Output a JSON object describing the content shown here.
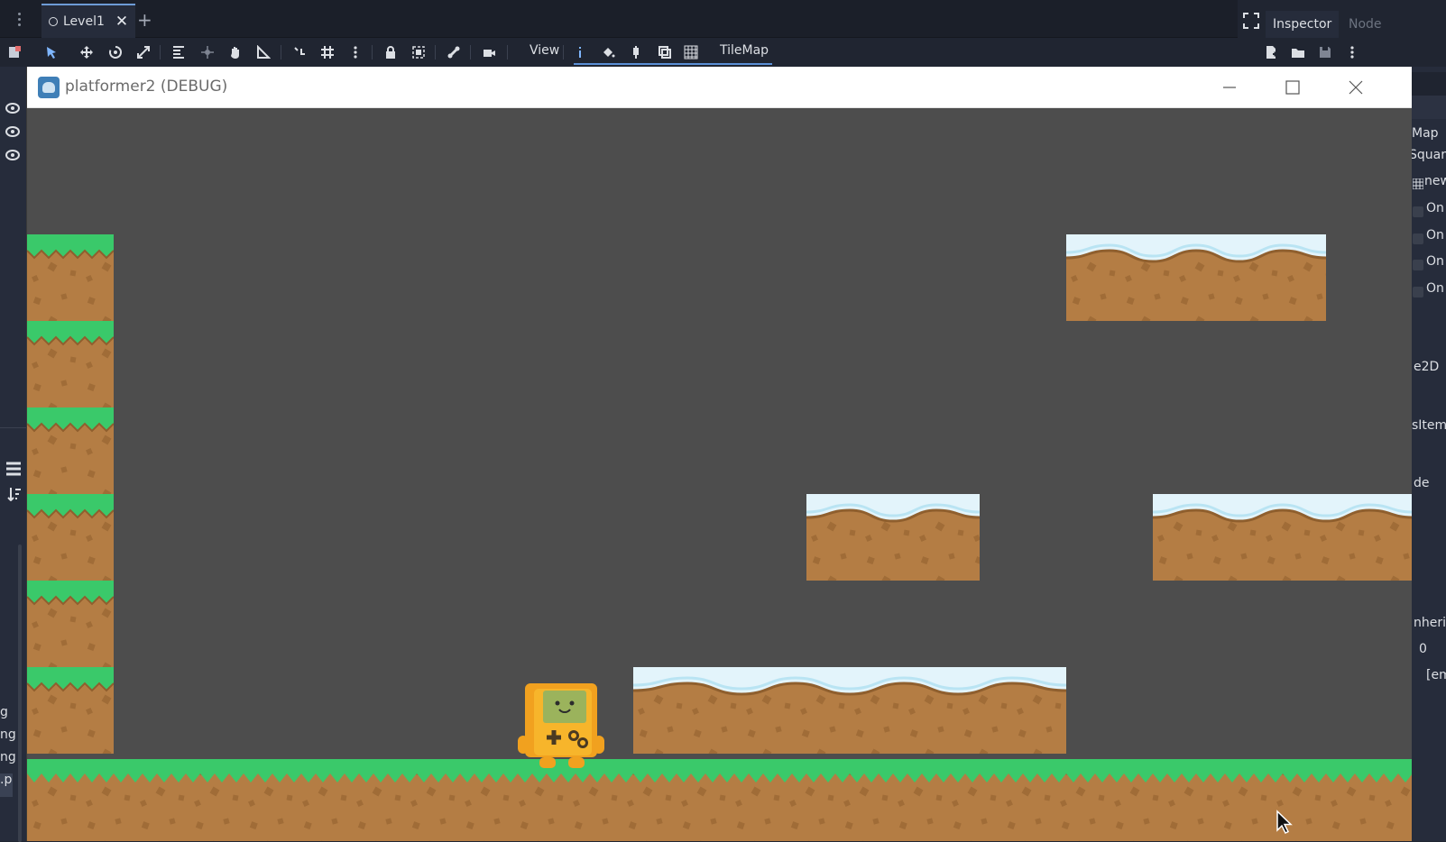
{
  "editor": {
    "scene_tab": {
      "label": "Level1"
    },
    "toolbar": {
      "view_label": "View",
      "tilemap_label": "TileMap"
    },
    "dock": {
      "inspector_tab": "Inspector",
      "node_tab": "Node",
      "visible_fragments": [
        "Map",
        "Square",
        "new",
        "On",
        "On",
        "On",
        "On",
        "e2D",
        "sItem",
        "de",
        "nherit",
        "0",
        "[em"
      ]
    },
    "left_panel": {
      "visible_fragments": [
        "g",
        "ng",
        "ng",
        ".p"
      ]
    }
  },
  "game_window": {
    "title": "platformer2 (DEBUG)",
    "scene": {
      "background_color": "#4d4d4d",
      "player": "handheld-console-character",
      "grass_column_tiles": 6,
      "snow_platforms": 4
    }
  },
  "colors": {
    "editor_bg": "#202531",
    "accent": "#5b8fd6",
    "grass": "#3ac96a",
    "dirt": "#b47d44",
    "snow": "#e3f4fb"
  }
}
